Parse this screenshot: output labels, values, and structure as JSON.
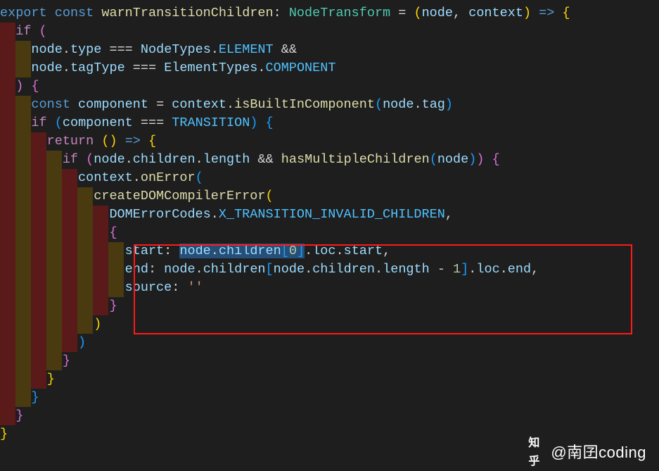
{
  "code": {
    "lines": [
      {
        "indent": 0,
        "tokens": [
          [
            "kw",
            "export"
          ],
          [
            "pun",
            " "
          ],
          [
            "kw",
            "const"
          ],
          [
            "pun",
            " "
          ],
          [
            "fn",
            "warnTransitionChildren"
          ],
          [
            "pun",
            ": "
          ],
          [
            "type",
            "NodeTransform"
          ],
          [
            "pun",
            " = "
          ],
          [
            "brace-y",
            "("
          ],
          [
            "var",
            "node"
          ],
          [
            "pun",
            ", "
          ],
          [
            "var",
            "context"
          ],
          [
            "brace-y",
            ")"
          ],
          [
            "pun",
            " "
          ],
          [
            "kw",
            "=>"
          ],
          [
            "pun",
            " "
          ],
          [
            "brace-y",
            "{"
          ]
        ]
      },
      {
        "indent": 1,
        "tokens": [
          [
            "kw2",
            "if"
          ],
          [
            "pun",
            " "
          ],
          [
            "brace-p",
            "("
          ]
        ]
      },
      {
        "indent": 2,
        "tokens": [
          [
            "var",
            "node"
          ],
          [
            "pun",
            "."
          ],
          [
            "prop",
            "type"
          ],
          [
            "pun",
            " === "
          ],
          [
            "var",
            "NodeTypes"
          ],
          [
            "pun",
            "."
          ],
          [
            "con",
            "ELEMENT"
          ],
          [
            "pun",
            " &&"
          ]
        ]
      },
      {
        "indent": 2,
        "tokens": [
          [
            "var",
            "node"
          ],
          [
            "pun",
            "."
          ],
          [
            "prop",
            "tagType"
          ],
          [
            "pun",
            " === "
          ],
          [
            "var",
            "ElementTypes"
          ],
          [
            "pun",
            "."
          ],
          [
            "con",
            "COMPONENT"
          ]
        ]
      },
      {
        "indent": 1,
        "tokens": [
          [
            "brace-p",
            ")"
          ],
          [
            "pun",
            " "
          ],
          [
            "brace-p",
            "{"
          ]
        ]
      },
      {
        "indent": 2,
        "tokens": [
          [
            "kw",
            "const"
          ],
          [
            "pun",
            " "
          ],
          [
            "var",
            "component"
          ],
          [
            "pun",
            " = "
          ],
          [
            "var",
            "context"
          ],
          [
            "pun",
            "."
          ],
          [
            "fn",
            "isBuiltInComponent"
          ],
          [
            "brace-b",
            "("
          ],
          [
            "var",
            "node"
          ],
          [
            "pun",
            "."
          ],
          [
            "prop",
            "tag"
          ],
          [
            "brace-b",
            ")"
          ]
        ]
      },
      {
        "indent": 2,
        "tokens": [
          [
            "kw2",
            "if"
          ],
          [
            "pun",
            " "
          ],
          [
            "brace-b",
            "("
          ],
          [
            "var",
            "component"
          ],
          [
            "pun",
            " === "
          ],
          [
            "con",
            "TRANSITION"
          ],
          [
            "brace-b",
            ")"
          ],
          [
            "pun",
            " "
          ],
          [
            "brace-b",
            "{"
          ]
        ]
      },
      {
        "indent": 3,
        "tokens": [
          [
            "kw2",
            "return"
          ],
          [
            "pun",
            " "
          ],
          [
            "brace-y",
            "("
          ],
          [
            "brace-y",
            ")"
          ],
          [
            "pun",
            " "
          ],
          [
            "kw",
            "=>"
          ],
          [
            "pun",
            " "
          ],
          [
            "brace-y",
            "{"
          ]
        ]
      },
      {
        "indent": 4,
        "tokens": [
          [
            "kw2",
            "if"
          ],
          [
            "pun",
            " "
          ],
          [
            "brace-p",
            "("
          ],
          [
            "var",
            "node"
          ],
          [
            "pun",
            "."
          ],
          [
            "prop",
            "children"
          ],
          [
            "pun",
            "."
          ],
          [
            "prop",
            "length"
          ],
          [
            "pun",
            " && "
          ],
          [
            "fn",
            "hasMultipleChildren"
          ],
          [
            "brace-b",
            "("
          ],
          [
            "var",
            "node"
          ],
          [
            "brace-b",
            ")"
          ],
          [
            "brace-p",
            ")"
          ],
          [
            "pun",
            " "
          ],
          [
            "brace-p",
            "{"
          ]
        ]
      },
      {
        "indent": 5,
        "tokens": [
          [
            "var",
            "context"
          ],
          [
            "pun",
            "."
          ],
          [
            "fn",
            "onError"
          ],
          [
            "brace-b",
            "("
          ]
        ]
      },
      {
        "indent": 6,
        "tokens": [
          [
            "fn",
            "createDOMCompilerError"
          ],
          [
            "brace-y",
            "("
          ]
        ]
      },
      {
        "indent": 7,
        "tokens": [
          [
            "var",
            "DOMErrorCodes"
          ],
          [
            "pun",
            "."
          ],
          [
            "con",
            "X_TRANSITION_INVALID_CHILDREN"
          ],
          [
            "pun",
            ","
          ]
        ]
      },
      {
        "indent": 7,
        "tokens": [
          [
            "brace-p",
            "{"
          ]
        ]
      },
      {
        "indent": 8,
        "tokens": [
          [
            "prop",
            "start"
          ],
          [
            "pun",
            ": "
          ],
          [
            "sel-open",
            ""
          ],
          [
            "var",
            "node"
          ],
          [
            "pun",
            "."
          ],
          [
            "prop",
            "children"
          ],
          [
            "brace-b",
            "["
          ],
          [
            "num",
            "0"
          ],
          [
            "brace-b",
            "]"
          ],
          [
            "sel-close",
            ""
          ],
          [
            "pun",
            "."
          ],
          [
            "prop",
            "loc"
          ],
          [
            "pun",
            "."
          ],
          [
            "prop",
            "start"
          ],
          [
            "pun",
            ","
          ]
        ]
      },
      {
        "indent": 8,
        "tokens": [
          [
            "prop",
            "end"
          ],
          [
            "pun",
            ": "
          ],
          [
            "var",
            "node"
          ],
          [
            "pun",
            "."
          ],
          [
            "prop",
            "children"
          ],
          [
            "brace-b",
            "["
          ],
          [
            "var",
            "node"
          ],
          [
            "pun",
            "."
          ],
          [
            "prop",
            "children"
          ],
          [
            "pun",
            "."
          ],
          [
            "prop",
            "length"
          ],
          [
            "pun",
            " - "
          ],
          [
            "num",
            "1"
          ],
          [
            "brace-b",
            "]"
          ],
          [
            "pun",
            "."
          ],
          [
            "prop",
            "loc"
          ],
          [
            "pun",
            "."
          ],
          [
            "prop",
            "end"
          ],
          [
            "pun",
            ","
          ]
        ]
      },
      {
        "indent": 8,
        "tokens": [
          [
            "prop",
            "source"
          ],
          [
            "pun",
            ": "
          ],
          [
            "str",
            "''"
          ]
        ]
      },
      {
        "indent": 7,
        "tokens": [
          [
            "brace-p",
            "}"
          ]
        ]
      },
      {
        "indent": 6,
        "tokens": [
          [
            "brace-y",
            ")"
          ]
        ]
      },
      {
        "indent": 5,
        "tokens": [
          [
            "brace-b",
            ")"
          ]
        ]
      },
      {
        "indent": 4,
        "tokens": [
          [
            "brace-p",
            "}"
          ]
        ]
      },
      {
        "indent": 3,
        "tokens": [
          [
            "brace-y",
            "}"
          ]
        ]
      },
      {
        "indent": 2,
        "tokens": [
          [
            "brace-b",
            "}"
          ]
        ]
      },
      {
        "indent": 1,
        "tokens": [
          [
            "brace-p",
            "}"
          ]
        ]
      },
      {
        "indent": 0,
        "tokens": [
          [
            "brace-y",
            "}"
          ]
        ]
      }
    ],
    "indent_unit": "  ",
    "highlight_box_lines": {
      "start": 13,
      "end": 17
    }
  },
  "watermark": {
    "author": "@南囝coding",
    "site_glyph": "知乎"
  }
}
